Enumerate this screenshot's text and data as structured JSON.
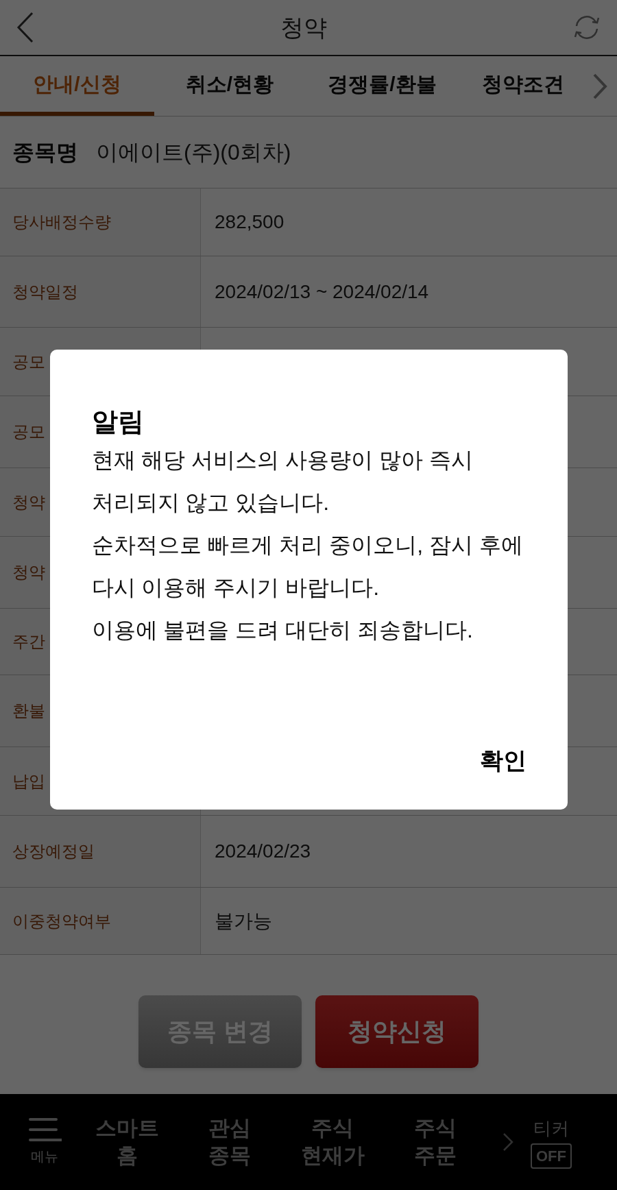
{
  "header": {
    "title": "청약"
  },
  "tabs": [
    {
      "label": "안내/신청",
      "selected": true
    },
    {
      "label": "취소/현황",
      "selected": false
    },
    {
      "label": "경쟁률/환불",
      "selected": false
    },
    {
      "label": "청약조견",
      "selected": false
    }
  ],
  "stock": {
    "label": "종목명",
    "value": "이에이트(주)(0회차)"
  },
  "rows": [
    {
      "label": "당사배정수량",
      "value": "282,500"
    },
    {
      "label": "청약일정",
      "value": "2024/02/13 ~ 2024/02/14"
    },
    {
      "label": "공모"
    },
    {
      "label": "공모"
    },
    {
      "label": "청약"
    },
    {
      "label": "청약"
    },
    {
      "label": "주간"
    },
    {
      "label": "환불"
    },
    {
      "label": "납입"
    },
    {
      "label": "상장예정일",
      "value": "2024/02/23"
    },
    {
      "label": "이중청약여부",
      "value": "불가능"
    }
  ],
  "buttons": [
    {
      "label": "종목 변경",
      "kind": "secondary"
    },
    {
      "label": "청약신청",
      "kind": "primary"
    }
  ],
  "bottom_nav": {
    "menu_label": "메뉴",
    "items": [
      "스마트\n홈",
      "관심\n종목",
      "주식\n현재가",
      "주식\n주문"
    ],
    "ticker": {
      "label": "티커",
      "state": "OFF"
    }
  },
  "dialog": {
    "title": "알림",
    "message": "현재 해당 서비스의 사용량이 많아 즉시 처리되지 않고 있습니다.\n순차적으로 빠르게 처리 중이오니, 잠시 후에 다시 이용해 주시기 바랍니다.\n이용에 불편을 드려 대단히 죄송합니다.",
    "confirm": "확인"
  }
}
